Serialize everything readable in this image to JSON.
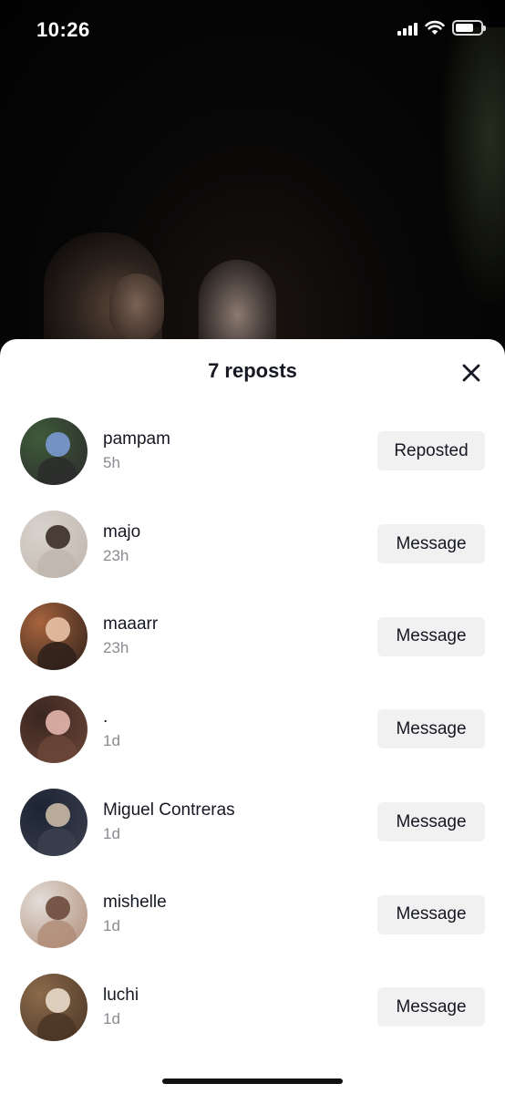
{
  "status_bar": {
    "time": "10:26",
    "icons": [
      "cellular-signal-icon",
      "wifi-icon",
      "battery-icon"
    ]
  },
  "sheet": {
    "title": "7 reposts",
    "close_icon": "close-icon"
  },
  "reposts": [
    {
      "name": "pampam",
      "time": "5h",
      "action": "Reposted",
      "avatar_colors": [
        "#3f5a3a",
        "#7a9ad1",
        "#2b2b2b"
      ]
    },
    {
      "name": "majo",
      "time": "23h",
      "action": "Message",
      "avatar_colors": [
        "#d8d2cc",
        "#3a2d26",
        "#bfb6ae"
      ]
    },
    {
      "name": "maaarr",
      "time": "23h",
      "action": "Message",
      "avatar_colors": [
        "#a8643d",
        "#e8c2a6",
        "#2d201a"
      ]
    },
    {
      "name": ".",
      "time": "1d",
      "action": "Message",
      "avatar_colors": [
        "#3a2620",
        "#e4b6ad",
        "#6b4538"
      ]
    },
    {
      "name": "Miguel Contreras",
      "time": "1d",
      "action": "Message",
      "avatar_colors": [
        "#1d2433",
        "#c9b9a5",
        "#3a3f4d"
      ]
    },
    {
      "name": "mishelle",
      "time": "1d",
      "action": "Message",
      "avatar_colors": [
        "#e2ddd8",
        "#6c4a3a",
        "#b08d78"
      ]
    },
    {
      "name": "luchi",
      "time": "1d",
      "action": "Message",
      "avatar_colors": [
        "#8a6a4a",
        "#e9dccb",
        "#4a3526"
      ]
    }
  ]
}
